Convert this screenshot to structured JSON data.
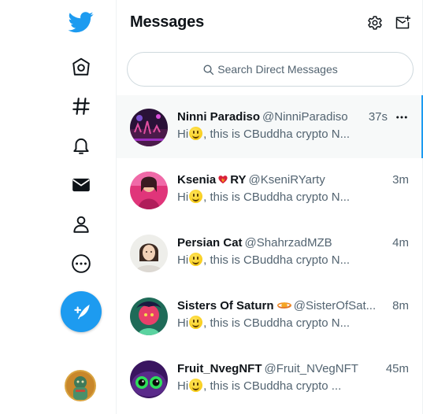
{
  "app": {
    "brand_color": "#1d9bf0"
  },
  "nav": {
    "items": [
      {
        "name": "home-icon"
      },
      {
        "name": "explore-icon"
      },
      {
        "name": "notifications-icon"
      },
      {
        "name": "messages-icon"
      },
      {
        "name": "profile-icon"
      },
      {
        "name": "more-icon"
      }
    ],
    "compose_icon": "compose-tweet-icon"
  },
  "messages": {
    "title": "Messages",
    "settings_icon": "gear-icon",
    "new_message_icon": "new-message-icon",
    "search": {
      "placeholder": "Search Direct Messages",
      "icon": "search-icon"
    },
    "conversations": [
      {
        "name": "Ninni Paradiso",
        "handle": "@NinniParadiso",
        "time": "37s",
        "preview_prefix": "Hi",
        "preview_text": ", this is CBuddha crypto N...",
        "selected": true
      },
      {
        "name": "Ksenia",
        "name_suffix": "RY",
        "handle": "@KseniRYarty",
        "time": "3m",
        "preview_prefix": "Hi",
        "preview_text": ", this is CBuddha crypto N..."
      },
      {
        "name": "Persian Cat",
        "handle": "@ShahrzadMZB",
        "time": "4m",
        "preview_prefix": "Hi",
        "preview_text": ", this is CBuddha crypto N..."
      },
      {
        "name": "Sisters Of Saturn",
        "handle": "@SisterOfSat...",
        "time": "8m",
        "preview_prefix": "Hi",
        "preview_text": ", this is CBuddha crypto N..."
      },
      {
        "name": "Fruit_NvegNFT",
        "handle": "@Fruit_NVegNFT",
        "time": "45m",
        "preview_prefix": "Hi",
        "preview_text": ", this is CBuddha crypto ..."
      }
    ]
  }
}
